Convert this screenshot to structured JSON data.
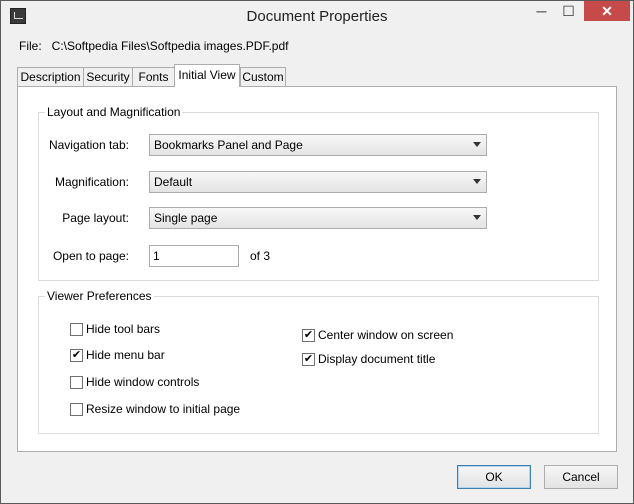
{
  "window": {
    "title": "Document Properties"
  },
  "titlebar": {
    "minimize_glyph": "─",
    "maximize_glyph": "☐",
    "close_glyph": "✕"
  },
  "file": {
    "label": "File:",
    "path": "C:\\Softpedia Files\\Softpedia images.PDF.pdf"
  },
  "tabs": [
    {
      "label": "Description",
      "active": false
    },
    {
      "label": "Security",
      "active": false
    },
    {
      "label": "Fonts",
      "active": false
    },
    {
      "label": "Initial View",
      "active": true
    },
    {
      "label": "Custom",
      "active": false
    }
  ],
  "layout": {
    "group_title": "Layout and Magnification",
    "navigation_tab": {
      "label": "Navigation tab:",
      "value": "Bookmarks Panel and Page"
    },
    "magnification": {
      "label": "Magnification:",
      "value": "Default"
    },
    "page_layout": {
      "label": "Page layout:",
      "value": "Single page"
    },
    "open_to_page": {
      "label": "Open to page:",
      "value": "1",
      "of_text": "of 3"
    }
  },
  "viewer": {
    "group_title": "Viewer Preferences",
    "options": [
      {
        "label": "Hide tool bars",
        "checked": false
      },
      {
        "label": "Hide menu bar",
        "checked": true
      },
      {
        "label": "Hide window controls",
        "checked": false
      },
      {
        "label": "Resize window to initial page",
        "checked": false
      },
      {
        "label": "Center window on screen",
        "checked": true
      },
      {
        "label": "Display document title",
        "checked": true
      }
    ]
  },
  "buttons": {
    "ok": "OK",
    "cancel": "Cancel"
  }
}
